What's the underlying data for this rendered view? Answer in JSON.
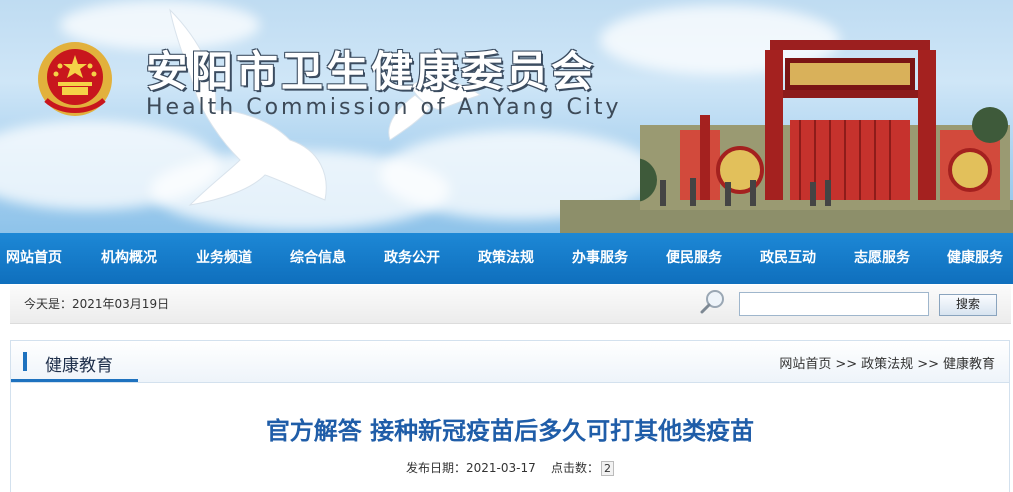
{
  "site": {
    "title_cn": "安阳市卫生健康委员会",
    "title_en": "Health Commission of AnYang City",
    "emblem_icon": "national-emblem-icon"
  },
  "colors": {
    "nav_bg": "#1378c8",
    "title_blue": "#1f5da8",
    "accent": "#1e72bf"
  },
  "nav": {
    "items": [
      {
        "label": "网站首页"
      },
      {
        "label": "机构概况"
      },
      {
        "label": "业务频道"
      },
      {
        "label": "综合信息"
      },
      {
        "label": "政务公开"
      },
      {
        "label": "政策法规"
      },
      {
        "label": "办事服务"
      },
      {
        "label": "便民服务"
      },
      {
        "label": "政民互动"
      },
      {
        "label": "志愿服务"
      },
      {
        "label": "健康服务"
      }
    ]
  },
  "infobar": {
    "today": "今天是：2021年03月19日",
    "search_placeholder": "",
    "search_button": "搜索",
    "search_icon": "magnifier-icon"
  },
  "section": {
    "title": "健康教育",
    "breadcrumb": [
      "网站首页",
      "政策法规",
      "健康教育"
    ],
    "breadcrumb_sep": ">>"
  },
  "article": {
    "title": "官方解答 接种新冠疫苗后多久可打其他类疫苗",
    "date_label": "发布日期：",
    "date": "2021-03-17",
    "hits_label": "点击数：",
    "hits": "2"
  }
}
